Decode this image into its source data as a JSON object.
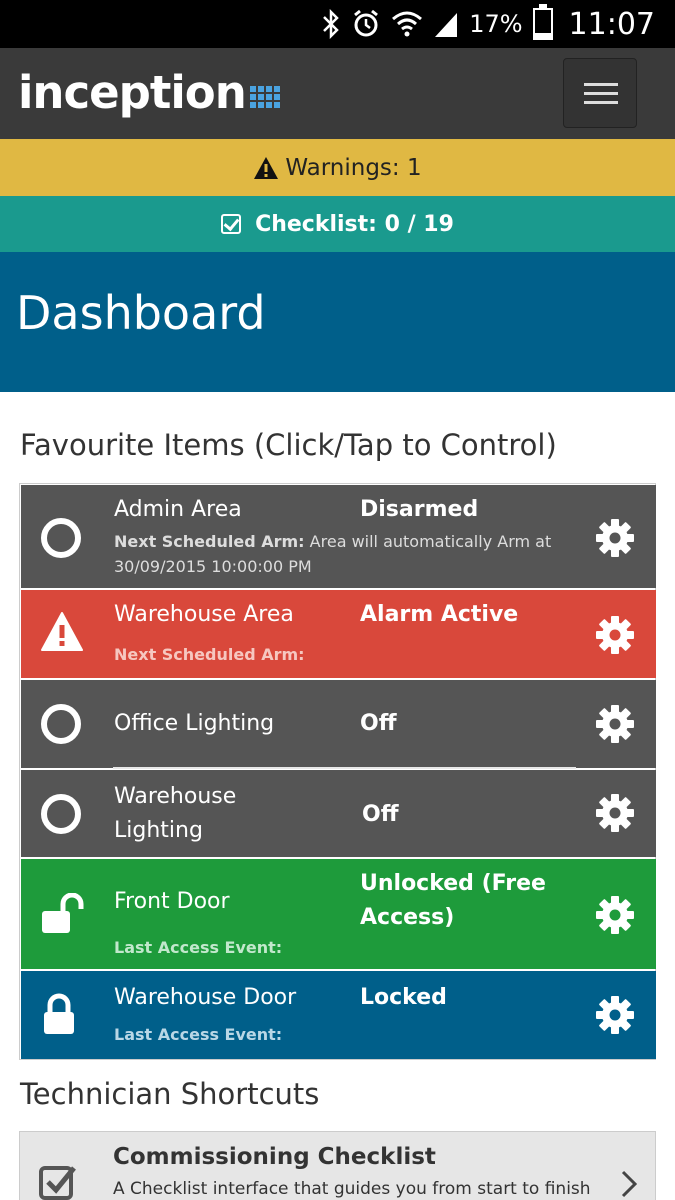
{
  "status_bar": {
    "battery_percent": "17%",
    "battery_level": 0.17,
    "time": "11:07",
    "icons": [
      "bluetooth-icon",
      "alarm-clock-icon",
      "wifi-icon",
      "signal-icon",
      "battery-icon"
    ]
  },
  "header": {
    "logo_text": "inception",
    "menu_icon": "hamburger-icon"
  },
  "alerts": {
    "warnings_label": "Warnings: 1",
    "checklist_label": "Checklist: 0 / 19"
  },
  "page": {
    "title": "Dashboard"
  },
  "favourites": {
    "heading": "Favourite Items (Click/Tap to Control)",
    "items": [
      {
        "name": "Admin Area",
        "state": "Disarmed",
        "sub_label": "Next Scheduled Arm:",
        "sub_value": "Area will automatically Arm at",
        "sub_value2": "30/09/2015 10:00:00 PM",
        "icon": "ring-icon",
        "color": "#555555"
      },
      {
        "name": "Warehouse Area",
        "state": "Alarm Active",
        "sub_label": "Next Scheduled Arm:",
        "icon": "warning-icon",
        "color": "#d9483b"
      },
      {
        "name": "Office Lighting",
        "state": "Off",
        "icon": "ring-icon",
        "color": "#555555"
      },
      {
        "name": "Warehouse",
        "name2": "Lighting",
        "state": "Off",
        "icon": "ring-icon",
        "color": "#555555"
      },
      {
        "name": "Front Door",
        "state": "Unlocked (Free",
        "state2": "Access)",
        "sub_label": "Last Access Event:",
        "icon": "unlocked-padlock-icon",
        "color": "#1e9b3b"
      },
      {
        "name": "Warehouse Door",
        "state": "Locked",
        "sub_label": "Last Access Event:",
        "icon": "locked-padlock-icon",
        "color": "#005f8a"
      }
    ]
  },
  "technician": {
    "heading": "Technician Shortcuts",
    "items": [
      {
        "title": "Commissioning Checklist",
        "description": "A Checklist interface that guides you from start to finish"
      }
    ]
  }
}
